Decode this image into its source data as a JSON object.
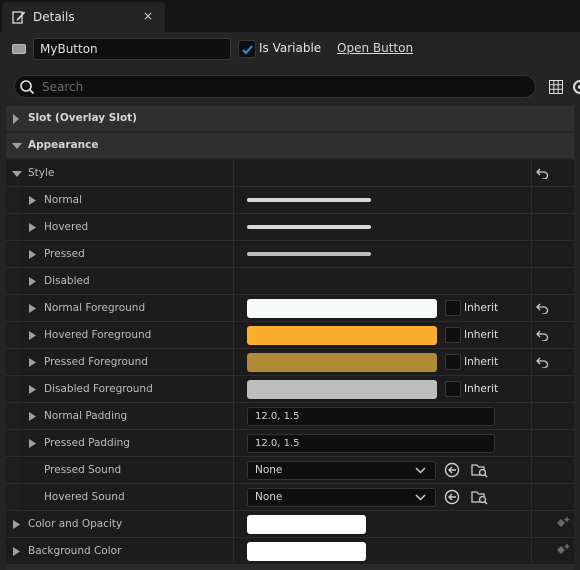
{
  "tab": {
    "title": "Details",
    "close": "×"
  },
  "header": {
    "name_value": "MyButton",
    "is_variable_label": "Is Variable",
    "is_variable_checked": true,
    "open_button_label": "Open Button"
  },
  "search": {
    "placeholder": "Search"
  },
  "sections": {
    "slot": "Slot (Overlay Slot)",
    "appearance": "Appearance",
    "style": "Style",
    "color_opacity": "Color and Opacity",
    "background_color": "Background Color"
  },
  "props": {
    "normal": "Normal",
    "hovered": "Hovered",
    "pressed": "Pressed",
    "disabled": "Disabled",
    "normal_fg": "Normal Foreground",
    "hovered_fg": "Hovered Foreground",
    "pressed_fg": "Pressed Foreground",
    "disabled_fg": "Disabled Foreground",
    "normal_padding": "Normal Padding",
    "pressed_padding": "Pressed Padding",
    "pressed_sound": "Pressed Sound",
    "hovered_sound": "Hovered Sound"
  },
  "values": {
    "inherit": "Inherit",
    "normal_padding": "12.0, 1.5",
    "pressed_padding": "12.0, 1.5",
    "pressed_sound": "None",
    "hovered_sound": "None"
  },
  "colors": {
    "normal_fg": "#f7fbf7",
    "hovered_fg": "#fbb02b",
    "pressed_fg": "#b08a35",
    "disabled_fg": "#bdbdbd",
    "checkbox_accent": "#2e8fe8"
  },
  "icons": [
    "details-icon",
    "close-icon",
    "widget-icon",
    "checkmark-icon",
    "search-icon",
    "grid-icon",
    "gear-icon",
    "expand-arrow-icon",
    "collapse-arrow-icon",
    "reset-icon",
    "chevron-down-icon",
    "use-selected-icon",
    "browse-icon",
    "keyframe-icon"
  ]
}
